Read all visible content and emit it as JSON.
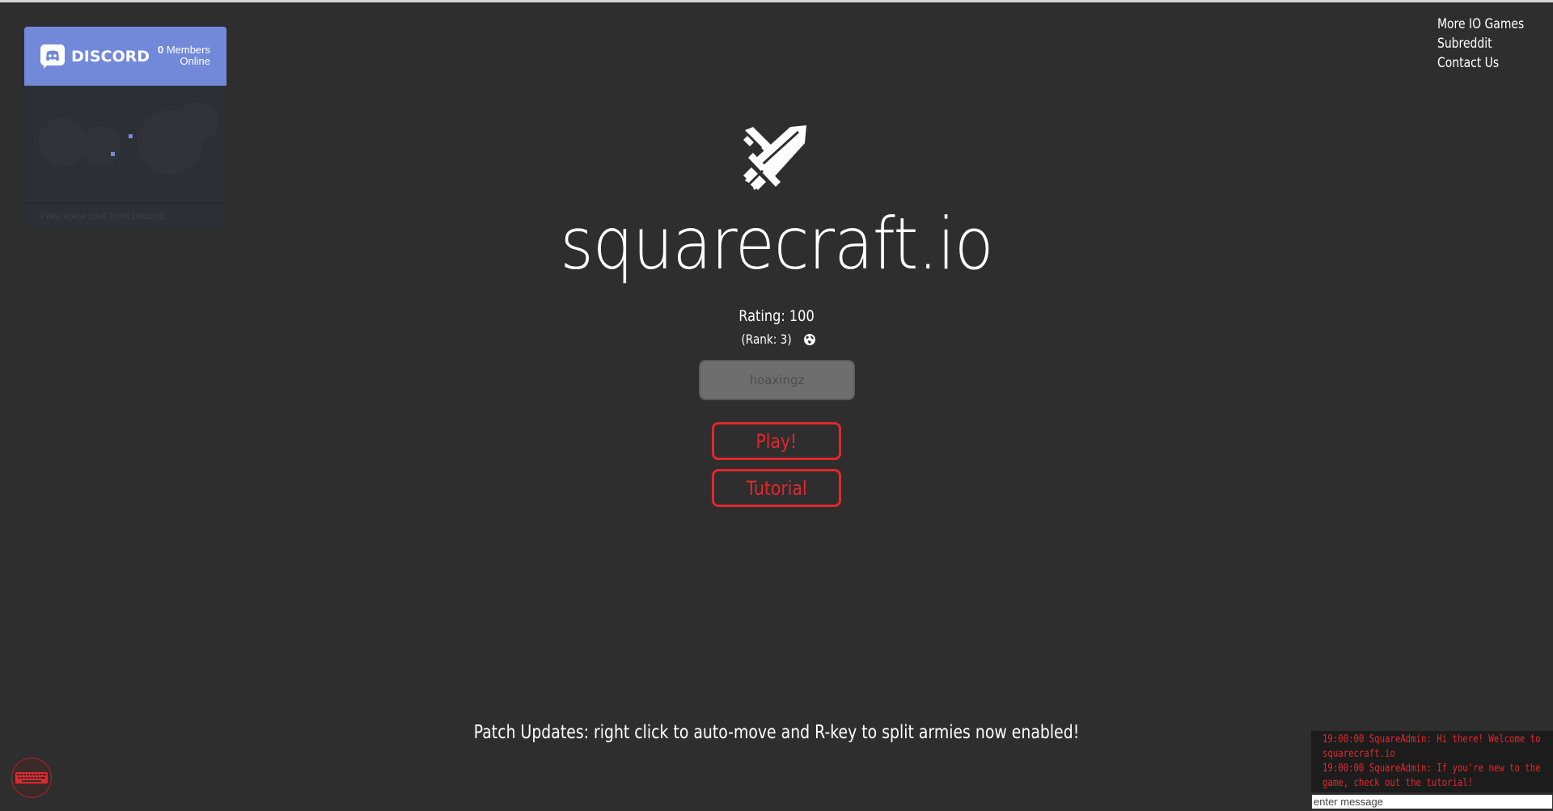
{
  "discord": {
    "wordmark": "DISCORD",
    "members_count": "0",
    "members_label": "Members",
    "online_label": "Online",
    "footer_text": "Free voice chat from Discord",
    "brand_color": "#7289da"
  },
  "top_links": [
    "More IO Games",
    "Subreddit",
    "Contact Us"
  ],
  "game": {
    "logo_icon": "crossed-swords-icon",
    "title": "squarecraft.io",
    "rating_label": "Rating: 100",
    "rank_label": "(Rank: 3)",
    "name_placeholder": "hoaxingz",
    "play_label": "Play!",
    "tutorial_label": "Tutorial",
    "accent_color": "#e0282d"
  },
  "patch_notes": "Patch Updates: right click to auto-move and R-key to split armies now enabled!",
  "chat": {
    "messages": [
      "19:00:00 SquareAdmin: Hi there! Welcome to squarecraft.io",
      "19:00:00 SquareAdmin: If you're new to the game, check out the tutorial!"
    ],
    "input_placeholder": "enter message"
  }
}
